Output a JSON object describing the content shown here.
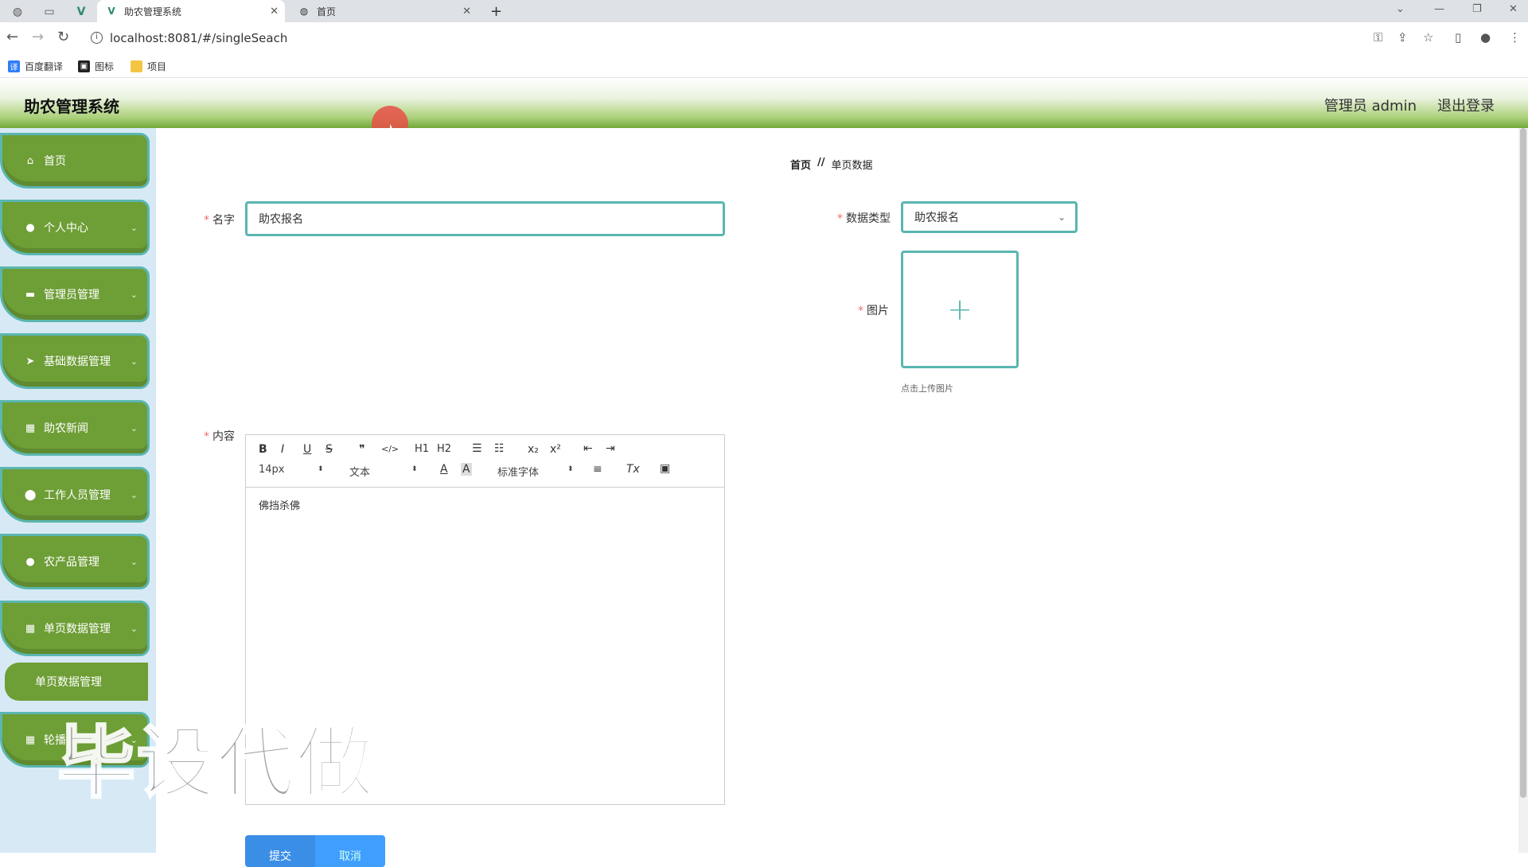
{
  "browser": {
    "tabs": [
      {
        "label": "助农管理系统",
        "active": true
      },
      {
        "label": "首页",
        "active": false
      }
    ],
    "new_tab_symbol": "+",
    "url": "localhost:8081/#/singleSeach",
    "bookmarks": [
      {
        "label": "百度翻译",
        "icon": "translate-icon",
        "color": "#2f7dfa"
      },
      {
        "label": "图标",
        "icon": "image-icon",
        "color": "#222222"
      },
      {
        "label": "项目",
        "icon": "folder-icon",
        "color": "#f4c542"
      }
    ]
  },
  "header": {
    "title": "助农管理系统",
    "admin_label": "管理员 admin",
    "logout_label": "退出登录"
  },
  "sidebar": {
    "items": [
      {
        "label": "首页",
        "icon": "home-icon",
        "has_children": false
      },
      {
        "label": "个人中心",
        "icon": "user-icon",
        "has_children": true
      },
      {
        "label": "管理员管理",
        "icon": "ticket-icon",
        "has_children": true
      },
      {
        "label": "基础数据管理",
        "icon": "send-icon",
        "has_children": true
      },
      {
        "label": "助农新闻",
        "icon": "grid-icon",
        "has_children": true
      },
      {
        "label": "工作人员管理",
        "icon": "location-icon",
        "has_children": true
      },
      {
        "label": "农产品管理",
        "icon": "user-icon",
        "has_children": true
      },
      {
        "label": "单页数据管理",
        "icon": "grid-icon",
        "has_children": true
      },
      {
        "label": "轮播",
        "icon": "grid-icon",
        "has_children": true
      }
    ],
    "active_submenu": "单页数据管理"
  },
  "breadcrumb": {
    "home": "首页",
    "separator": "//",
    "current": "单页数据"
  },
  "form": {
    "name_label": "名字",
    "name_value": "助农报名",
    "type_label": "数据类型",
    "type_value": "助农报名",
    "image_label": "图片",
    "upload_tip": "点击上传图片",
    "content_label": "内容",
    "content_value": "佛挡杀佛",
    "required_mark": "*"
  },
  "editor_toolbar": {
    "font_size": "14px",
    "header_select": "文本",
    "font_family": "标准字体",
    "buttons": [
      "B",
      "I",
      "U",
      "S",
      "❞",
      "</>",
      "H1",
      "H2",
      "ol",
      "ul",
      "x₂",
      "x²",
      "outdent",
      "indent",
      "A",
      "A-bg",
      "align",
      "Tx",
      "image"
    ]
  },
  "actions": {
    "submit_label": "提交",
    "reset_label": "取消"
  },
  "overlay": {
    "watermark_text": "毕设代做"
  },
  "colors": {
    "menu_green": "#6e9e36",
    "accent_teal": "#5ab6b0",
    "primary_blue": "#409eff"
  }
}
